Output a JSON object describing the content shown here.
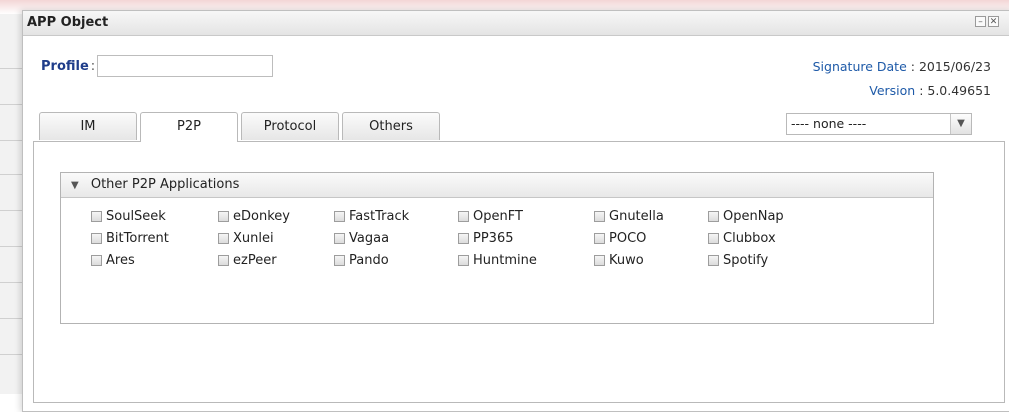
{
  "dialog": {
    "title": "APP Object"
  },
  "profile": {
    "label": "Profile",
    "colon": ":",
    "value": ""
  },
  "signature": {
    "date_label": "Signature Date",
    "date_value": "2015/06/23",
    "version_label": "Version",
    "version_value": "5.0.49651"
  },
  "tabs": [
    "IM",
    "P2P",
    "Protocol",
    "Others"
  ],
  "active_tab": "P2P",
  "select": {
    "value": "---- none ----"
  },
  "group": {
    "title": "Other P2P Applications",
    "rows": [
      [
        "SoulSeek",
        "eDonkey",
        "FastTrack",
        "OpenFT",
        "Gnutella",
        "OpenNap"
      ],
      [
        "BitTorrent",
        "Xunlei",
        "Vagaa",
        "PP365",
        "POCO",
        "Clubbox"
      ],
      [
        "Ares",
        "ezPeer",
        "Pando",
        "Huntmine",
        "Kuwo",
        "Spotify"
      ]
    ]
  },
  "colors": {
    "label_blue": "#1f3d8a",
    "link_blue": "#1e5aa8"
  }
}
